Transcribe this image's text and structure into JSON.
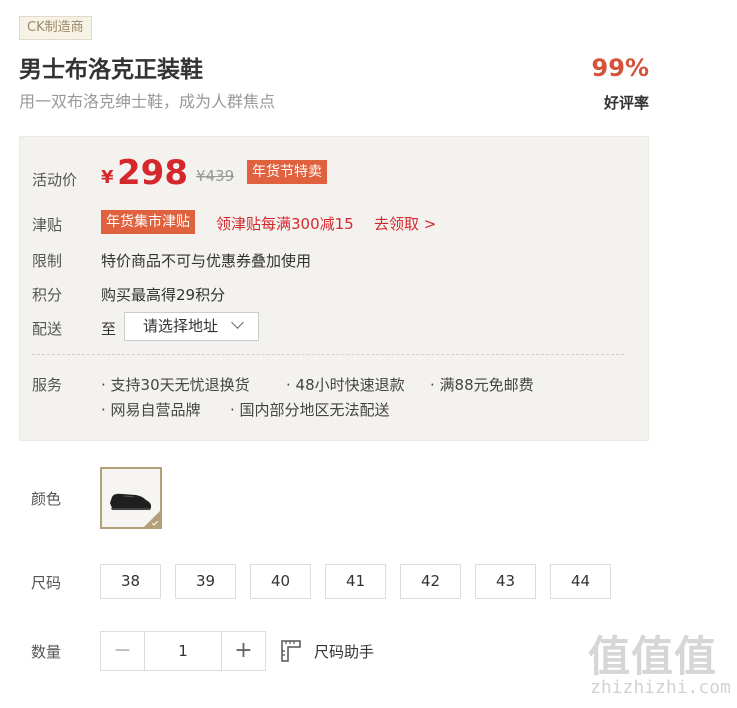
{
  "product": {
    "brand_tag": "CK制造商",
    "title": "男士布洛克正装鞋",
    "subtitle": "用一双布洛克绅士鞋，成为人群焦点",
    "rating_percent": "99%",
    "rating_label": "好评率"
  },
  "panel": {
    "price_label": "活动价",
    "currency": "¥",
    "price": "298",
    "original_price": "¥439",
    "promo_tag": "年货节特卖",
    "subsidy_label": "津贴",
    "subsidy_tag": "年货集市津贴",
    "subsidy_text": "领津贴每满300减15",
    "subsidy_link": "去领取 >",
    "limit_label": "限制",
    "limit_text": "特价商品不可与优惠券叠加使用",
    "points_label": "积分",
    "points_text": "购买最高得29积分",
    "delivery_label": "配送",
    "delivery_to": "至",
    "address_placeholder": "请选择地址",
    "service_label": "服务",
    "services": [
      "· 支持30天无忧退换货",
      "· 48小时快速退款",
      "· 满88元免邮费",
      "· 网易自营品牌",
      "· 国内部分地区无法配送"
    ]
  },
  "options": {
    "color_label": "颜色",
    "size_label": "尺码",
    "sizes": [
      "38",
      "39",
      "40",
      "41",
      "42",
      "43",
      "44"
    ],
    "quantity_label": "数量",
    "quantity_minus": "−",
    "quantity": "1",
    "quantity_plus": "+",
    "size_helper": "尺码助手"
  },
  "watermark": {
    "logo": "值值值",
    "url": "zhizhizhi.com"
  },
  "colors": {
    "accent": "#d4282d",
    "promo": "#e0613e",
    "rating": "#d4533a",
    "panel_bg": "#f4f2ef",
    "swatch_border": "#b4a078"
  },
  "icons": {
    "size_helper": "ruler-icon",
    "address_dropdown": "chevron-down-icon",
    "selected_swatch": "check-icon"
  }
}
